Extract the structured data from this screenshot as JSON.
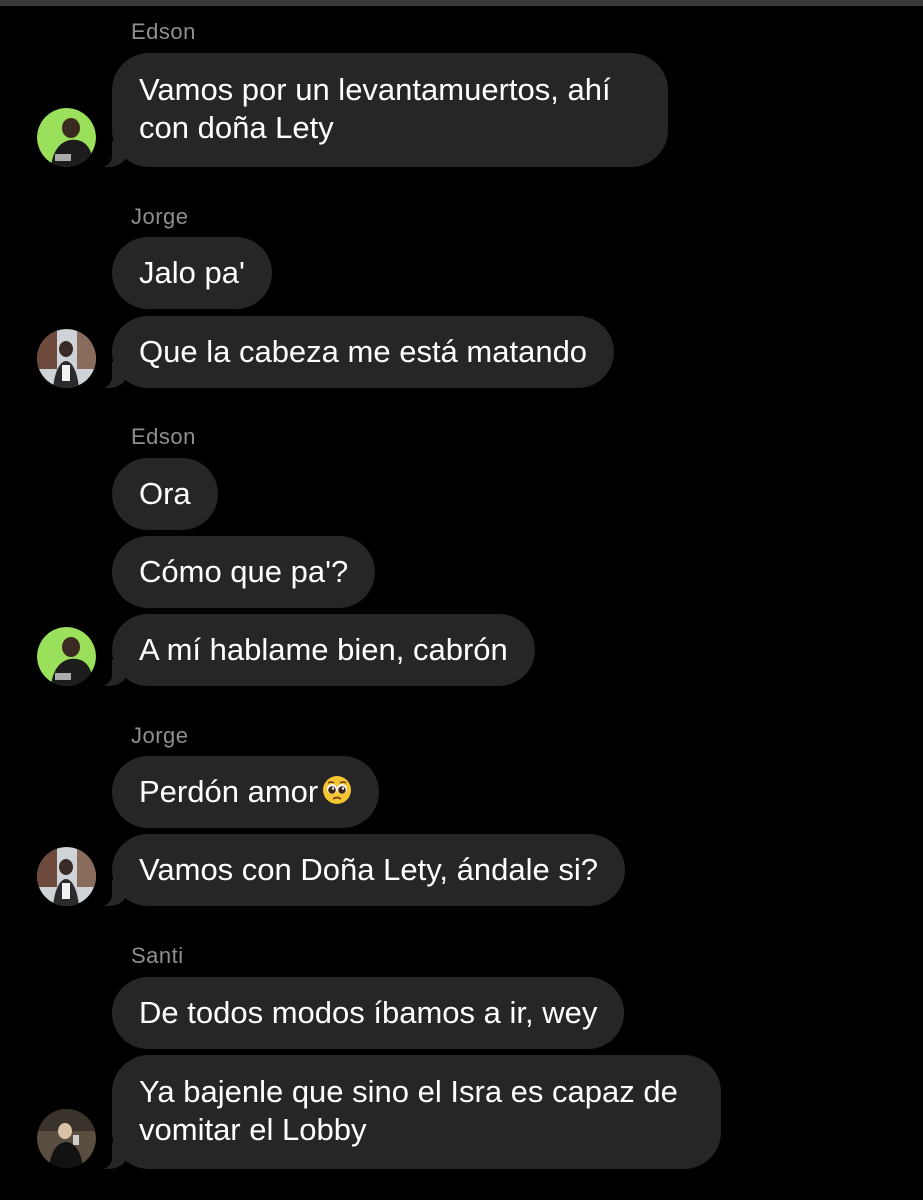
{
  "messages": [
    {
      "sender": "Edson",
      "bubbles": [
        "Vamos por un levantamuertos, ahí\ncon doña Lety"
      ]
    },
    {
      "sender": "Jorge",
      "bubbles": [
        "Jalo pa'",
        "Que la cabeza me está matando"
      ]
    },
    {
      "sender": "Edson",
      "bubbles": [
        "Ora",
        "Cómo que pa'?",
        "A mí hablame bien, cabrón"
      ]
    },
    {
      "sender": "Jorge",
      "bubbles": [
        "Perdón amor",
        "Vamos con Doña Lety, ándale si?"
      ]
    },
    {
      "sender": "Santi",
      "bubbles": [
        "De todos modos íbamos a ir, wey",
        "Ya bajenle que sino el Isra es capaz de\nvomitar el Lobby"
      ]
    }
  ],
  "emoji": {
    "pleading_face": "pleading-face-icon"
  },
  "colors": {
    "background": "#000000",
    "bubble": "#262629",
    "text": "#ffffff",
    "sender_name": "#8e8e93",
    "avatar_edson_bg": "#9ae05a"
  }
}
